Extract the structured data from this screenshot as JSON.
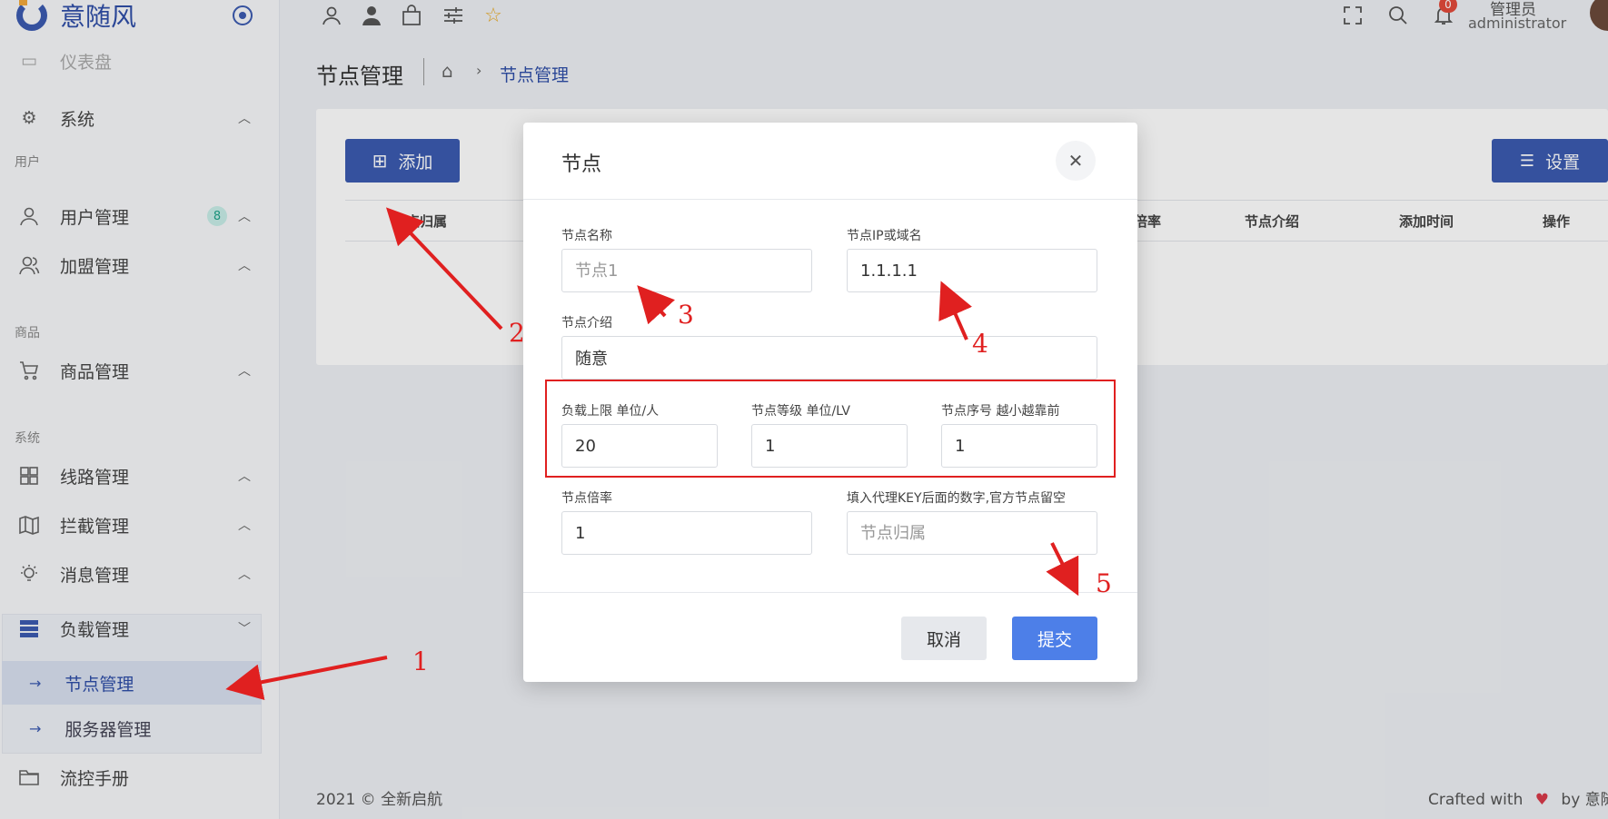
{
  "brand": {
    "title": "意随风"
  },
  "sidebar": {
    "partial_item": "仪表盘",
    "sections": {
      "user": "用户",
      "goods": "商品",
      "system": "系统"
    },
    "items": [
      {
        "label": "系统",
        "icon": "gear-icon"
      },
      {
        "label": "用户管理",
        "icon": "user-icon",
        "badge": "8"
      },
      {
        "label": "加盟管理",
        "icon": "users-icon"
      },
      {
        "label": "商品管理",
        "icon": "cart-icon"
      },
      {
        "label": "线路管理",
        "icon": "grid-icon"
      },
      {
        "label": "拦截管理",
        "icon": "map-icon"
      },
      {
        "label": "消息管理",
        "icon": "bulb-icon"
      },
      {
        "label": "负载管理",
        "icon": "server-icon"
      },
      {
        "label": "流控手册",
        "icon": "folder-icon"
      }
    ],
    "sub_items": [
      {
        "label": "节点管理"
      },
      {
        "label": "服务器管理"
      }
    ]
  },
  "header": {
    "notification_count": "0",
    "user_role": "管理员",
    "user_name": "administrator"
  },
  "page": {
    "title": "节点管理",
    "breadcrumb_current": "节点管理",
    "add_button": "添加",
    "settings_button": "设置",
    "table_headers": [
      "节点归属",
      "倍率",
      "节点介绍",
      "添加时间",
      "操作"
    ]
  },
  "modal": {
    "title": "节点",
    "fields": {
      "name": {
        "label": "节点名称",
        "placeholder": "节点1"
      },
      "ip": {
        "label": "节点IP或域名",
        "value": "1.1.1.1"
      },
      "intro": {
        "label": "节点介绍",
        "value": "随意"
      },
      "load": {
        "label": "负载上限 单位/人",
        "value": "20"
      },
      "level": {
        "label": "节点等级 单位/LV",
        "value": "1"
      },
      "order": {
        "label": "节点序号 越小越靠前",
        "value": "1"
      },
      "rate": {
        "label": "节点倍率",
        "value": "1"
      },
      "owner": {
        "label": "填入代理KEY后面的数字,官方节点留空",
        "placeholder": "节点归属"
      }
    },
    "cancel": "取消",
    "submit": "提交"
  },
  "footer": {
    "copyright": "2021 © 全新启航",
    "crafted_prefix": "Crafted with",
    "crafted_suffix": "by 意随"
  },
  "annotations": [
    "1",
    "2",
    "3",
    "4",
    "5"
  ],
  "colors": {
    "primary": "#3b5bb0",
    "submit": "#4d7fe8",
    "annotation": "#e02020"
  }
}
